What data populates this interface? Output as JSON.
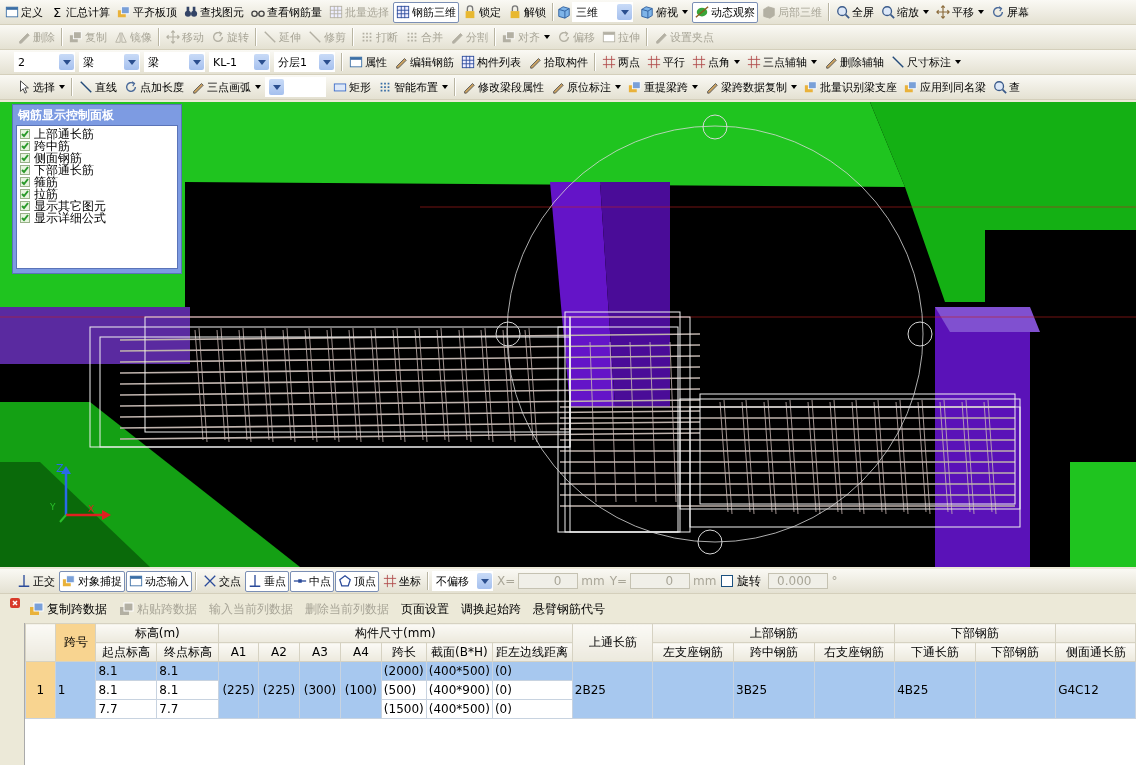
{
  "toolbars": [
    {
      "items": [
        {
          "kind": "button",
          "label": "定义",
          "disabled": false,
          "pressed": false,
          "dropdown": false
        },
        {
          "kind": "button",
          "label": "汇总计算",
          "glyph": "Σ",
          "disabled": false,
          "pressed": false,
          "dropdown": false
        },
        {
          "kind": "button",
          "label": "平齐板顶",
          "disabled": false,
          "pressed": false,
          "dropdown": false
        },
        {
          "kind": "button",
          "label": "查找图元",
          "disabled": false,
          "pressed": false,
          "dropdown": false
        },
        {
          "kind": "button",
          "label": "查看钢筋量",
          "disabled": false,
          "pressed": false,
          "dropdown": false
        },
        {
          "kind": "button",
          "label": "批量选择",
          "disabled": true,
          "pressed": false,
          "dropdown": false
        },
        {
          "kind": "button",
          "label": "钢筋三维",
          "disabled": false,
          "pressed": true,
          "dropdown": false
        },
        {
          "kind": "button",
          "label": "锁定",
          "disabled": false,
          "pressed": false,
          "dropdown": false
        },
        {
          "kind": "button",
          "label": "解锁",
          "disabled": false,
          "pressed": false,
          "dropdown": false
        },
        {
          "kind": "separator"
        },
        {
          "kind": "combo",
          "value": "三维"
        },
        {
          "kind": "button",
          "label": "俯视",
          "disabled": false,
          "pressed": false,
          "dropdown": true
        },
        {
          "kind": "button",
          "label": "动态观察",
          "disabled": false,
          "pressed": true,
          "dropdown": false
        },
        {
          "kind": "button",
          "label": "局部三维",
          "disabled": true,
          "pressed": false,
          "dropdown": false
        },
        {
          "kind": "separator"
        },
        {
          "kind": "button",
          "label": "全屏",
          "disabled": false,
          "pressed": false,
          "dropdown": false
        },
        {
          "kind": "button",
          "label": "缩放",
          "disabled": false,
          "pressed": false,
          "dropdown": true
        },
        {
          "kind": "button",
          "label": "平移",
          "disabled": false,
          "pressed": false,
          "dropdown": true
        },
        {
          "kind": "button",
          "label": "屏幕",
          "disabled": false,
          "pressed": false,
          "dropdown": false
        }
      ]
    },
    {
      "items": [
        {
          "kind": "button",
          "label": "删除",
          "disabled": true,
          "pressed": false,
          "dropdown": false
        },
        {
          "kind": "separator"
        },
        {
          "kind": "button",
          "label": "复制",
          "disabled": true,
          "pressed": false,
          "dropdown": false
        },
        {
          "kind": "button",
          "label": "镜像",
          "disabled": true,
          "pressed": false,
          "dropdown": false
        },
        {
          "kind": "separator"
        },
        {
          "kind": "button",
          "label": "移动",
          "disabled": true,
          "pressed": false,
          "dropdown": false
        },
        {
          "kind": "button",
          "label": "旋转",
          "disabled": true,
          "pressed": false,
          "dropdown": false
        },
        {
          "kind": "separator"
        },
        {
          "kind": "button",
          "label": "延伸",
          "disabled": true,
          "pressed": false,
          "dropdown": false
        },
        {
          "kind": "button",
          "label": "修剪",
          "disabled": true,
          "pressed": false,
          "dropdown": false
        },
        {
          "kind": "separator"
        },
        {
          "kind": "button",
          "label": "打断",
          "disabled": true,
          "pressed": false,
          "dropdown": false
        },
        {
          "kind": "button",
          "label": "合并",
          "disabled": true,
          "pressed": false,
          "dropdown": false
        },
        {
          "kind": "button",
          "label": "分割",
          "disabled": true,
          "pressed": false,
          "dropdown": false
        },
        {
          "kind": "separator"
        },
        {
          "kind": "button",
          "label": "对齐",
          "disabled": true,
          "pressed": false,
          "dropdown": true
        },
        {
          "kind": "button",
          "label": "偏移",
          "disabled": true,
          "pressed": false,
          "dropdown": false
        },
        {
          "kind": "button",
          "label": "拉伸",
          "disabled": true,
          "pressed": false,
          "dropdown": false
        },
        {
          "kind": "separator"
        },
        {
          "kind": "button",
          "label": "设置夹点",
          "disabled": true,
          "pressed": false,
          "dropdown": false
        }
      ]
    },
    {
      "items": [
        {
          "kind": "combo",
          "value": "2"
        },
        {
          "kind": "combo",
          "value": "梁"
        },
        {
          "kind": "combo",
          "value": "梁"
        },
        {
          "kind": "combo",
          "value": "KL-1"
        },
        {
          "kind": "combo",
          "value": "分层1"
        },
        {
          "kind": "separator"
        },
        {
          "kind": "button",
          "label": "属性",
          "disabled": false,
          "pressed": false,
          "dropdown": false
        },
        {
          "kind": "button",
          "label": "编辑钢筋",
          "disabled": false,
          "pressed": false,
          "dropdown": false
        },
        {
          "kind": "button",
          "label": "构件列表",
          "disabled": false,
          "pressed": false,
          "dropdown": false
        },
        {
          "kind": "button",
          "label": "拾取构件",
          "disabled": false,
          "pressed": false,
          "dropdown": false
        },
        {
          "kind": "separator"
        },
        {
          "kind": "button",
          "label": "两点",
          "disabled": false,
          "pressed": false,
          "dropdown": false
        },
        {
          "kind": "button",
          "label": "平行",
          "disabled": false,
          "pressed": false,
          "dropdown": false
        },
        {
          "kind": "button",
          "label": "点角",
          "disabled": false,
          "pressed": false,
          "dropdown": true
        },
        {
          "kind": "button",
          "label": "三点辅轴",
          "disabled": false,
          "pressed": false,
          "dropdown": true
        },
        {
          "kind": "button",
          "label": "删除辅轴",
          "disabled": false,
          "pressed": false,
          "dropdown": false
        },
        {
          "kind": "button",
          "label": "尺寸标注",
          "disabled": false,
          "pressed": false,
          "dropdown": true
        }
      ]
    },
    {
      "items": [
        {
          "kind": "button",
          "label": "选择",
          "disabled": false,
          "pressed": false,
          "dropdown": true
        },
        {
          "kind": "separator"
        },
        {
          "kind": "button",
          "label": "直线",
          "disabled": false,
          "pressed": false,
          "dropdown": false
        },
        {
          "kind": "button",
          "label": "点加长度",
          "disabled": false,
          "pressed": false,
          "dropdown": false
        },
        {
          "kind": "button",
          "label": "三点画弧",
          "disabled": false,
          "pressed": false,
          "dropdown": true
        },
        {
          "kind": "combo"
        },
        {
          "kind": "button",
          "label": "矩形",
          "disabled": false,
          "pressed": false,
          "dropdown": false
        },
        {
          "kind": "button",
          "label": "智能布置",
          "disabled": false,
          "pressed": false,
          "dropdown": true
        },
        {
          "kind": "separator"
        },
        {
          "kind": "button",
          "label": "修改梁段属性",
          "disabled": false,
          "pressed": false,
          "dropdown": false
        },
        {
          "kind": "button",
          "label": "原位标注",
          "disabled": false,
          "pressed": false,
          "dropdown": true
        },
        {
          "kind": "button",
          "label": "重提梁跨",
          "disabled": false,
          "pressed": false,
          "dropdown": true
        },
        {
          "kind": "button",
          "label": "梁跨数据复制",
          "disabled": false,
          "pressed": false,
          "dropdown": true
        },
        {
          "kind": "button",
          "label": "批量识别梁支座",
          "disabled": false,
          "pressed": false,
          "dropdown": false
        },
        {
          "kind": "button",
          "label": "应用到同名梁",
          "disabled": false,
          "pressed": false,
          "dropdown": false
        },
        {
          "kind": "button",
          "label": "查",
          "disabled": false,
          "pressed": false,
          "dropdown": false
        }
      ]
    }
  ],
  "viewport": {
    "panel": {
      "title": "钢筋显示控制面板",
      "options": [
        {
          "label": "上部通长筋",
          "checked": true
        },
        {
          "label": "跨中筋",
          "checked": true
        },
        {
          "label": "侧面钢筋",
          "checked": true
        },
        {
          "label": "下部通长筋",
          "checked": true
        },
        {
          "label": "箍筋",
          "checked": true
        },
        {
          "label": "拉筋",
          "checked": true
        },
        {
          "label": "显示其它图元",
          "checked": true
        },
        {
          "label": "显示详细公式",
          "checked": true
        }
      ]
    },
    "axis_labels": [
      "Z",
      "Y",
      "X"
    ]
  },
  "snap_toolbar": {
    "items": [
      {
        "kind": "button",
        "label": "正交",
        "disabled": false,
        "pressed": false,
        "dropdown": false
      },
      {
        "kind": "button",
        "label": "对象捕捉",
        "disabled": false,
        "pressed": true,
        "dropdown": false
      },
      {
        "kind": "button",
        "label": "动态输入",
        "disabled": false,
        "pressed": true,
        "dropdown": false
      },
      {
        "kind": "separator"
      },
      {
        "kind": "button",
        "label": "交点",
        "disabled": false,
        "pressed": false,
        "dropdown": false
      },
      {
        "kind": "button",
        "label": "垂点",
        "disabled": false,
        "pressed": true,
        "dropdown": false
      },
      {
        "kind": "button",
        "label": "中点",
        "disabled": false,
        "pressed": true,
        "dropdown": false
      },
      {
        "kind": "button",
        "label": "顶点",
        "disabled": false,
        "pressed": true,
        "dropdown": false
      },
      {
        "kind": "button",
        "label": "坐标",
        "disabled": false,
        "pressed": false,
        "dropdown": false
      },
      {
        "kind": "separator"
      },
      {
        "kind": "combo",
        "value": "不偏移"
      },
      {
        "kind": "field",
        "label": "X=",
        "value": "0",
        "unit": "mm",
        "disabled": true
      },
      {
        "kind": "field",
        "label": "Y=",
        "value": "0",
        "unit": "mm",
        "disabled": true
      },
      {
        "kind": "checkbox",
        "label": "旋转",
        "checked": false
      },
      {
        "kind": "field",
        "value": "0.000",
        "unit": "°",
        "disabled": true
      }
    ]
  },
  "table_toolbar": {
    "items": [
      {
        "kind": "button",
        "label": "复制跨数据",
        "disabled": false,
        "pressed": false,
        "dropdown": false
      },
      {
        "kind": "button",
        "label": "粘贴跨数据",
        "disabled": true,
        "pressed": false,
        "dropdown": false
      },
      {
        "kind": "button",
        "label": "输入当前列数据",
        "disabled": true,
        "pressed": false,
        "dropdown": false
      },
      {
        "kind": "button",
        "label": "删除当前列数据",
        "disabled": true,
        "pressed": false,
        "dropdown": false
      },
      {
        "kind": "button",
        "label": "页面设置",
        "disabled": false,
        "pressed": false,
        "dropdown": false
      },
      {
        "kind": "button",
        "label": "调换起始跨",
        "disabled": false,
        "pressed": false,
        "dropdown": false
      },
      {
        "kind": "button",
        "label": "悬臂钢筋代号",
        "disabled": false,
        "pressed": false,
        "dropdown": false
      }
    ]
  },
  "table": {
    "header": [
      {
        "label": "跨号"
      },
      {
        "label": "标高(m)",
        "children": [
          "起点标高",
          "终点标高"
        ]
      },
      {
        "label": "构件尺寸(mm)",
        "children": [
          "A1",
          "A2",
          "A3",
          "A4",
          "跨长",
          "截面(B*H)",
          "距左边线距离"
        ]
      },
      {
        "label": "上通长筋"
      },
      {
        "label": "上部钢筋",
        "children": [
          "左支座钢筋",
          "跨中钢筋",
          "右支座钢筋"
        ]
      },
      {
        "label": "下部钢筋",
        "children": [
          "下通长筋",
          "下部钢筋"
        ]
      },
      {
        "children": [
          "侧面通长筋"
        ]
      }
    ],
    "rows": [
      {
        "row_number": "1",
        "selected": true,
        "sub_rows": [
          {
            "selected": true
          },
          {
            "selected": false
          },
          {
            "selected": false
          }
        ],
        "cells": [
          {
            "text": "1"
          },
          {
            "per_row": [
              "8.1",
              "8.1",
              "7.7"
            ]
          },
          {
            "per_row": [
              "8.1",
              "8.1",
              "7.7"
            ]
          },
          {
            "text": "(225)"
          },
          {
            "text": "(225)"
          },
          {
            "text": "(300)"
          },
          {
            "text": "(100)"
          },
          {
            "per_row": [
              "(2000)",
              "(500)",
              "(1500)"
            ]
          },
          {
            "per_row": [
              "(400*500)",
              "(400*900)",
              "(400*500)"
            ]
          },
          {
            "per_row": [
              "(0)",
              "(0)",
              "(0)"
            ]
          },
          {
            "text": "2B25"
          },
          {},
          {
            "text": "3B25"
          },
          {},
          {
            "text": "4B25"
          },
          {},
          {
            "text": "G4C12"
          }
        ]
      }
    ]
  }
}
